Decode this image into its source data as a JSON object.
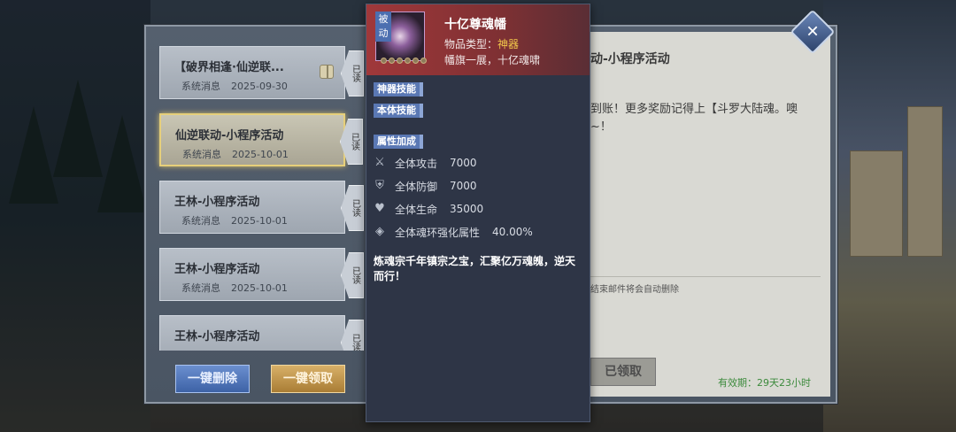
{
  "mail_list": [
    {
      "title": "【破界相逢·仙逆联...",
      "sender": "系统消息",
      "date": "2025-09-30",
      "read_tag": "已读",
      "has_gift": true,
      "selected": false
    },
    {
      "title": "仙逆联动-小程序活动",
      "sender": "系统消息",
      "date": "2025-10-01",
      "read_tag": "已读",
      "has_gift": false,
      "selected": true
    },
    {
      "title": "王林-小程序活动",
      "sender": "系统消息",
      "date": "2025-10-01",
      "read_tag": "已读",
      "has_gift": false,
      "selected": false
    },
    {
      "title": "王林-小程序活动",
      "sender": "系统消息",
      "date": "2025-10-01",
      "read_tag": "已读",
      "has_gift": false,
      "selected": false
    },
    {
      "title": "王林-小程序活动",
      "sender": "",
      "date": "",
      "read_tag": "已读",
      "has_gift": false,
      "selected": false
    }
  ],
  "buttons": {
    "delete_all": "一键删除",
    "claim_all": "一键领取",
    "claimed": "已领取"
  },
  "content": {
    "title": "动-小程序活动",
    "body": "到账！更多奖励记得上【斗罗大陆魂。噢~！",
    "note": "结束邮件将会自动删除",
    "validity": "有效期：29天23小时"
  },
  "tooltip": {
    "passive_badge": "被动",
    "item_name": "十亿尊魂幡",
    "type_label": "物品类型：",
    "type_value": "神器",
    "short_desc": "幡旗一展，十亿魂啸",
    "sections": {
      "artifact_skill": "神器技能",
      "base_skill": "本体技能",
      "attr_bonus": "属性加成"
    },
    "stats": [
      {
        "icon": "sword-icon",
        "label": "全体攻击",
        "value": "7000"
      },
      {
        "icon": "shield-icon",
        "label": "全体防御",
        "value": "7000"
      },
      {
        "icon": "heart-icon",
        "label": "全体生命",
        "value": "35000"
      },
      {
        "icon": "diamond-icon",
        "label": "全体魂环强化属性",
        "value": "40.00%"
      }
    ],
    "lore": "炼魂宗千年镇宗之宝，汇聚亿万魂魄，逆天而行！"
  },
  "colors": {
    "accent_gold": "#f2c84b",
    "header_red": "#a0383a",
    "tag_blue": "#5a78b4",
    "validity_green": "#3c8a3c"
  }
}
